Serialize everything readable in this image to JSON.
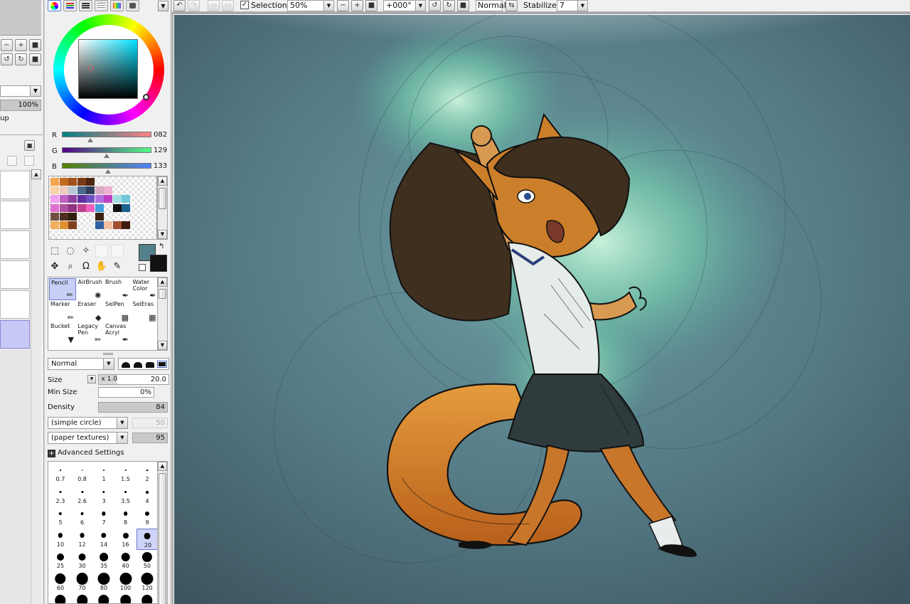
{
  "left_panel": {
    "zoom_percent": "100%",
    "group_label_fragment": "up",
    "buttons": [
      {
        "name": "zoom-out-button",
        "glyph": "−"
      },
      {
        "name": "zoom-in-button",
        "glyph": "+"
      },
      {
        "name": "zoom-reset-button",
        "glyph": "■"
      },
      {
        "name": "rotate-left-button",
        "glyph": "↺"
      },
      {
        "name": "rotate-right-button",
        "glyph": "↻"
      },
      {
        "name": "rotate-reset-button",
        "glyph": "■"
      }
    ]
  },
  "color": {
    "r": "082",
    "g": "129",
    "b": "133",
    "r_label": "R",
    "g_label": "G",
    "b_label": "B",
    "fg_color": "#52818B",
    "bg_color": "#111111"
  },
  "swatches": [
    [
      "#f2a650",
      "#c46a1f",
      "#a05318",
      "#7a3b14",
      "#4d2511",
      "#ffffff",
      "#ffffff",
      "#ffffff",
      "#ffffff",
      "#ffffff",
      "#ffffff",
      "#ffffff"
    ],
    [
      "#f7d3a8",
      "#f0c9c0",
      "#b8c8d8",
      "#4b6a8a",
      "#2f3d5c",
      "#d8a8c0",
      "#f0b0d0",
      "#ffffff",
      "#ffffff",
      "#ffffff",
      "#ffffff",
      "#ffffff"
    ],
    [
      "#f0a0f0",
      "#c060c0",
      "#9040a0",
      "#6030a0",
      "#7050c0",
      "#b070e0",
      "#c040c0",
      "#a0e0e0",
      "#70c8d8",
      "#ffffff",
      "#ffffff",
      "#ffffff"
    ],
    [
      "#e070d0",
      "#b050a0",
      "#903080",
      "#c04090",
      "#f060c0",
      "#40a0e0",
      "#ffffff",
      "#111111",
      "#1a6090",
      "#ffffff",
      "#ffffff",
      "#ffffff"
    ],
    [
      "#705040",
      "#503020",
      "#302010",
      "#ffffff",
      "#ffffff",
      "#3a2010",
      "#ffffff",
      "#ffffff",
      "#ffffff",
      "#ffffff",
      "#ffffff",
      "#ffffff"
    ],
    [
      "#f0b060",
      "#e09030",
      "#804020",
      "#ffffff",
      "#ffffff",
      "#3060a0",
      "#f0c0a0",
      "#a05030",
      "#401a10",
      "#ffffff",
      "#ffffff",
      "#ffffff"
    ]
  ],
  "tools": {
    "row1": [
      {
        "name": "rect-select-icon",
        "glyph": "⬚"
      },
      {
        "name": "lasso-icon",
        "glyph": "◌"
      },
      {
        "name": "magic-wand-icon",
        "glyph": "✧"
      },
      {
        "name": "blank-tool-1",
        "glyph": ""
      },
      {
        "name": "blank-tool-2",
        "glyph": ""
      }
    ],
    "row2": [
      {
        "name": "move-icon",
        "glyph": "✥"
      },
      {
        "name": "zoom-icon",
        "glyph": "⌕"
      },
      {
        "name": "rotate-icon",
        "glyph": "Ω"
      },
      {
        "name": "hand-icon",
        "glyph": "✋"
      },
      {
        "name": "eyedropper-icon",
        "glyph": "✎"
      }
    ]
  },
  "brushes": [
    {
      "label": "Pencil",
      "icon": "✏",
      "selected": true
    },
    {
      "label": "AirBrush",
      "icon": "✺",
      "selected": false
    },
    {
      "label": "Brush",
      "icon": "✒",
      "selected": false
    },
    {
      "label": "Water Color",
      "icon": "✒",
      "selected": false
    },
    {
      "label": "Marker",
      "icon": "✏",
      "selected": false
    },
    {
      "label": "Eraser",
      "icon": "◆",
      "selected": false
    },
    {
      "label": "SelPen",
      "icon": "▦",
      "selected": false
    },
    {
      "label": "SelEras",
      "icon": "▦",
      "selected": false
    },
    {
      "label": "Bucket",
      "icon": "▼",
      "selected": false
    },
    {
      "label": "Legacy Pen",
      "icon": "✏",
      "selected": false
    },
    {
      "label": "Canvas Acryl",
      "icon": "✒",
      "selected": false
    },
    {
      "label": "",
      "icon": "",
      "selected": false
    }
  ],
  "brush_settings": {
    "blend_mode": "Normal",
    "size_label": "Size",
    "size_multiplier": "x 1.0",
    "size_value": "20.0",
    "min_size_label": "Min Size",
    "min_size_value": "0%",
    "density_label": "Density",
    "density_value": "84",
    "shape_dropdown": "(simple circle)",
    "shape_value": "50",
    "texture_dropdown": "(paper textures)",
    "texture_value": "95",
    "advanced_label": "Advanced Settings"
  },
  "brush_sizes": [
    [
      "0.7",
      "0.8",
      "1",
      "1.5",
      "2"
    ],
    [
      "2.3",
      "2.6",
      "3",
      "3.5",
      "4"
    ],
    [
      "5",
      "6",
      "7",
      "8",
      "9"
    ],
    [
      "10",
      "12",
      "14",
      "16",
      "20"
    ],
    [
      "25",
      "30",
      "35",
      "40",
      "50"
    ],
    [
      "60",
      "70",
      "80",
      "100",
      "120"
    ],
    [
      "",
      "",
      "",
      "",
      ""
    ]
  ],
  "selected_brush_size": "20",
  "toolbar": {
    "selection_label": "Selection",
    "selection_checked": "✓",
    "zoom_value": "50%",
    "rotation_value": "+000°",
    "blend_label": "Normal",
    "stabilizer_label": "Stabilizer",
    "stabilizer_value": "7",
    "undo_glyph": "↶",
    "redo_glyph": "↷",
    "zoom_out_glyph": "−",
    "zoom_in_glyph": "+",
    "reset_glyph": "■",
    "rotate_left_glyph": "↺",
    "rotate_right_glyph": "↻",
    "flip_glyph": "⇆"
  }
}
